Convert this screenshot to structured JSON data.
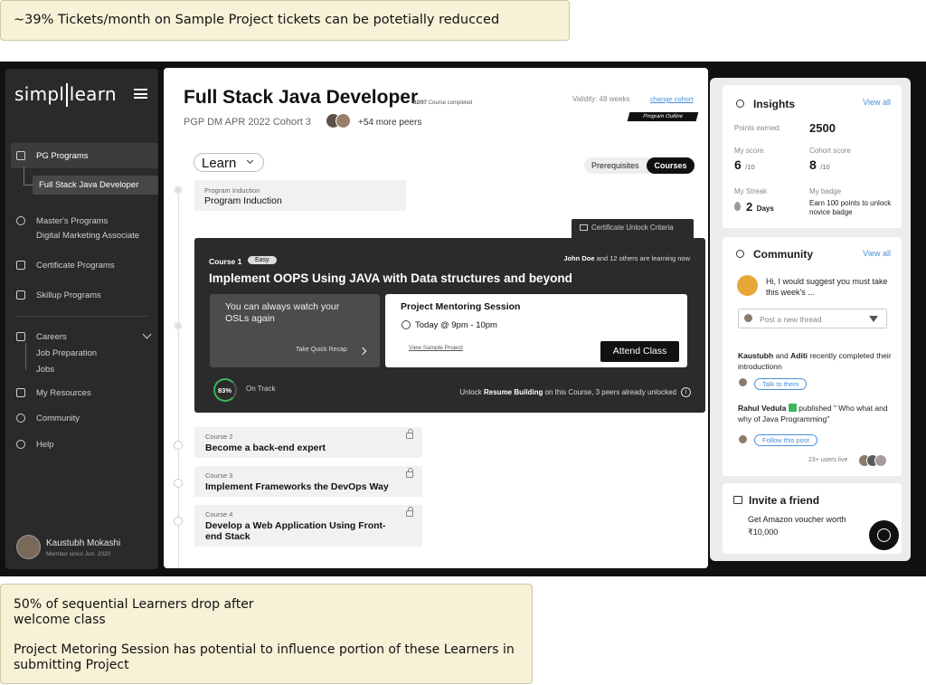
{
  "notes": {
    "top": "~39% Tickets/month on Sample Project tickets can be potetially reducced",
    "bottom_line1": "50% of sequential Learners drop after",
    "bottom_line2": "welcome class",
    "bottom_line3": "Project Metoring Session has potential to influence portion of these Learners in",
    "bottom_line4": "submitting Project"
  },
  "sidebar": {
    "logo_a": "simpl",
    "logo_b": "learn",
    "pg_programs": "PG Programs",
    "full_stack": "Full Stack Java Developer",
    "masters": "Master's Programs",
    "masters_sub": "Digital Marketing Associate",
    "certificate": "Certificate Programs",
    "skillup": "Skillup Programs",
    "careers": "Careers",
    "job_prep": "Job Preparation",
    "jobs": "Jobs",
    "resources": "My Resources",
    "community": "Community",
    "help": "Help",
    "user_name": "Kaustubh Mokashi",
    "user_since": "Member since Jun. 2020"
  },
  "header": {
    "title": "Full Stack Java Developer",
    "progress": "02/07",
    "progress_label": "Course completed",
    "cohort": "PGP DM APR 2022 Cohort 3",
    "peers": "+54 more peers",
    "validity": "Validity: 48 weeks",
    "change_cohort": "change cohort",
    "program_outline": "Program Outline"
  },
  "learn": {
    "dropdown": "Learn",
    "tab_prereq": "Prerequisites",
    "tab_courses": "Courses",
    "induction_small": "Program Induction",
    "induction_title": "Program Induction",
    "cert_unlock": "Certificate Unlock Criteria"
  },
  "course1": {
    "label": "Course 1",
    "badge": "Easy",
    "learners_name": "John Doe",
    "learners_rest": "and 12 others are learning now",
    "title": "Implement OOPS Using JAVA with Data structures and beyond",
    "recap_text": "You can always watch your OSLs again",
    "recap_link": "Take Quick Recap",
    "session_title": "Project Mentoring Session",
    "session_time": "Today @ 9pm - 10pm",
    "sample_project": "View Sample Project",
    "attend": "Attend Class",
    "progress_pct": "83%",
    "status": "On Track",
    "unlock_pre": "Unlock",
    "unlock_bold": "Resume Building",
    "unlock_post": "on this Course, 3 peers already unlocked"
  },
  "courses": [
    {
      "num": "Course 2",
      "title": "Become a back-end expert"
    },
    {
      "num": "Course 3",
      "title": "Implement Frameworks the DevOps Way"
    },
    {
      "num": "Course 4",
      "title": "Develop a Web Application Using Front-end Stack"
    }
  ],
  "insights": {
    "title": "Insights",
    "view_all": "View all",
    "points_label": "Points earned:",
    "points": "2500",
    "my_score_label": "My score",
    "my_score": "6",
    "my_score_of": "/10",
    "cohort_label": "Cohort score",
    "cohort_score": "8",
    "cohort_of": "/10",
    "streak_label": "My Streak",
    "streak": "2",
    "streak_unit": "Days",
    "badge_label": "My badge",
    "badge_text": "Earn 100 points to unlock novice badge"
  },
  "community": {
    "title": "Community",
    "view_all": "View all",
    "message": "Hi, I would suggest you must take this week's ...",
    "post_placeholder": "Post a new thread",
    "a1_name1": "Kaustubh",
    "a1_and": "and",
    "a1_name2": "Aditi",
    "a1_text": "recently completed their introductionn",
    "a1_chip": "Talk to them",
    "a2_name": "Rahul Vedula",
    "a2_text": "published \" Who what and why of Java Programming\"",
    "a2_chip": "Follow this post",
    "live": "23+ users live"
  },
  "invite": {
    "title": "Invite a friend",
    "text": "Get Amazon voucher worth ₹10,000"
  },
  "colors": {
    "accent": "#4a8fd8",
    "dark": "#2b2b2b",
    "green": "#3cb55b"
  }
}
